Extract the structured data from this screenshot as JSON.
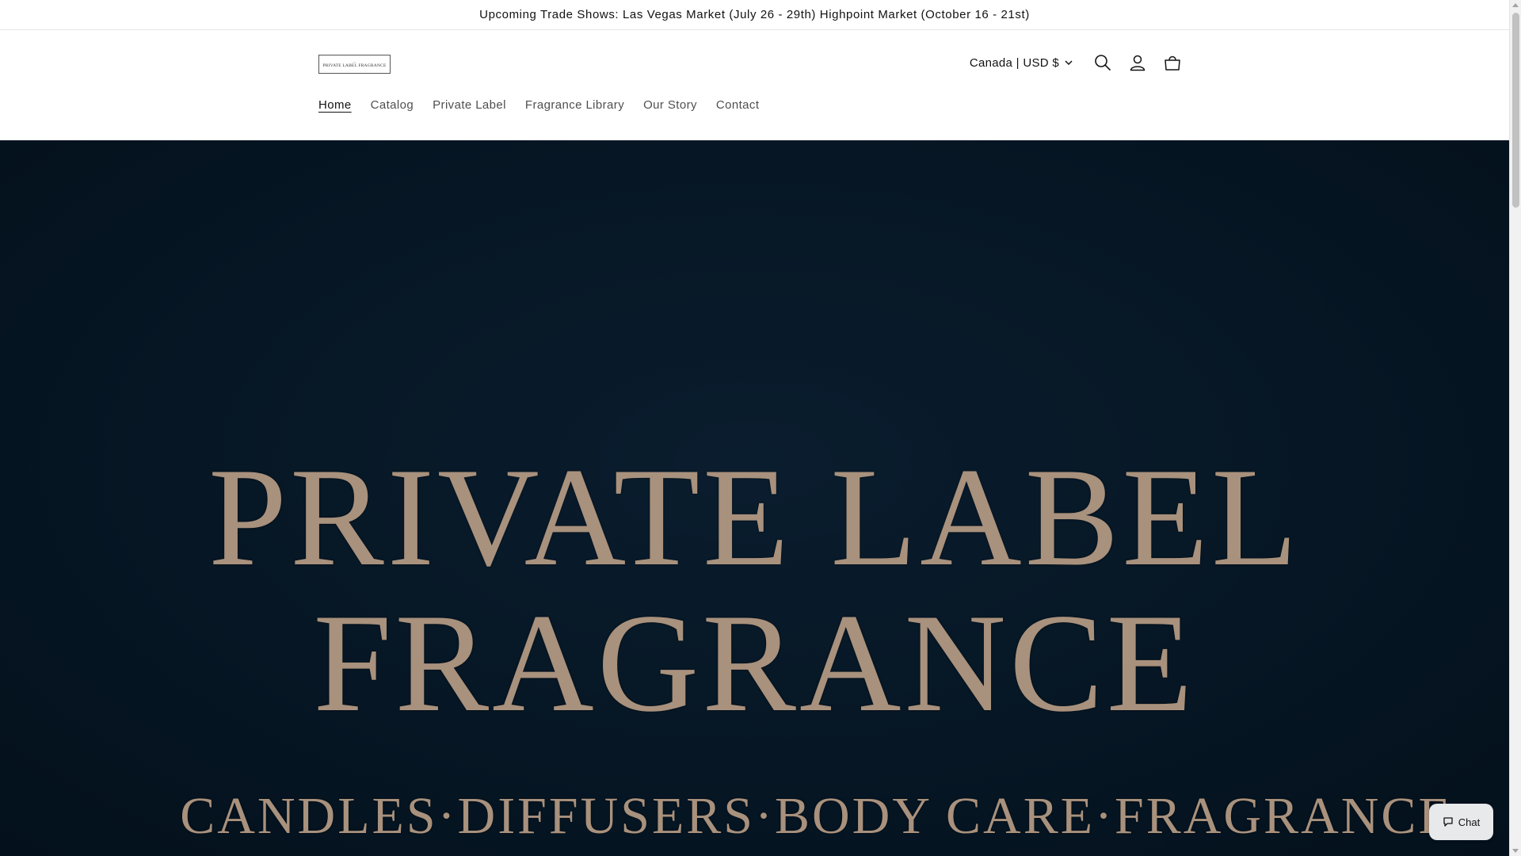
{
  "announcement": {
    "text": "Upcoming Trade Shows: Las Vegas Market (July 26 - 29th) Highpoint Market (October 16 - 21st)"
  },
  "header": {
    "logo": {
      "mark": "—",
      "text": "PRIVATE LABEL FRAGRANCE"
    },
    "currency_selector": {
      "value": "Canada | USD $",
      "icon": "chevron-down-icon"
    },
    "icons": {
      "search": "search-icon",
      "account": "account-icon",
      "cart": "cart-icon"
    }
  },
  "nav": {
    "items": [
      {
        "label": "Home",
        "active": true
      },
      {
        "label": "Catalog",
        "active": false
      },
      {
        "label": "Private Label",
        "active": false
      },
      {
        "label": "Fragrance Library",
        "active": false
      },
      {
        "label": "Our Story",
        "active": false
      },
      {
        "label": "Contact",
        "active": false
      }
    ]
  },
  "hero": {
    "line1": "PRIVATE LABEL",
    "line2": "FRAGRANCE",
    "line3": "CANDLES·DIFFUSERS·BODY CARE·FRAGRANCE"
  },
  "chat": {
    "label": "Chat",
    "icon": "chat-bubble-icon"
  },
  "colors": {
    "hero_bg": "#061624",
    "hero_text": "#a8917d",
    "nav_active": "#121212",
    "nav_inactive": "#5a5a5a"
  }
}
